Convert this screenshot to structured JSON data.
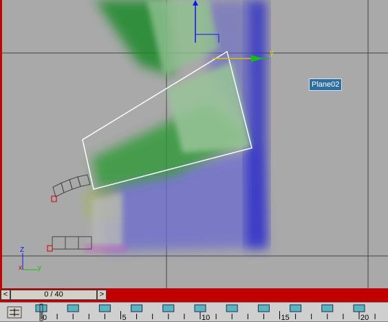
{
  "viewport": {
    "object_label": "Plane02",
    "gizmo_axis_label": "y",
    "corner_axis": {
      "z": "Z",
      "x": "x",
      "y": "y"
    }
  },
  "timeslider": {
    "frame_display": "0 / 40",
    "prev_label": "<",
    "next_label": ">"
  },
  "trackbar": {
    "tick_labels": [
      "0",
      "5",
      "10",
      "15",
      "20"
    ],
    "key_color": "#5bb4c4"
  },
  "colors": {
    "active_viewport_border": "#c40000",
    "timebar_red": "#c00000",
    "selection_white": "#ffffff"
  }
}
